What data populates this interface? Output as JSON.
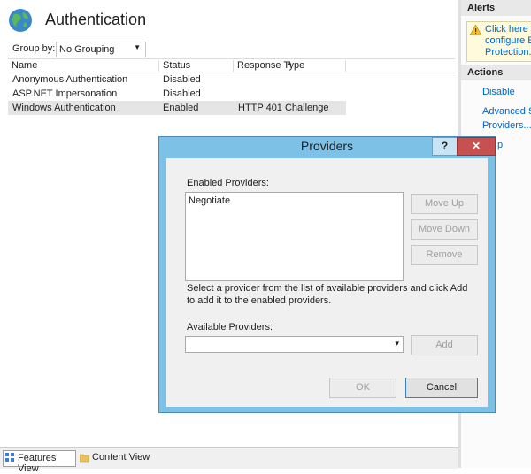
{
  "header": {
    "title": "Authentication"
  },
  "groupby": {
    "label": "Group by:",
    "value": "No Grouping"
  },
  "grid": {
    "columns": [
      "Name",
      "Status",
      "Response Type"
    ],
    "rows": [
      {
        "name": "Anonymous Authentication",
        "status": "Disabled",
        "response": ""
      },
      {
        "name": "ASP.NET Impersonation",
        "status": "Disabled",
        "response": ""
      },
      {
        "name": "Windows Authentication",
        "status": "Enabled",
        "response": "HTTP 401 Challenge"
      }
    ]
  },
  "tabs": {
    "features": "Features View",
    "content": "Content View"
  },
  "actions_pane": {
    "alerts_header": "Alerts",
    "alert_lines": [
      "Click here to",
      "configure Ex",
      "Protection."
    ],
    "actions_header": "Actions",
    "disable": "Disable",
    "advanced_line1": "Advanced Se",
    "advanced_line2": "Providers...",
    "help_fragment": "p"
  },
  "dialog": {
    "title": "Providers",
    "help_glyph": "?",
    "close_glyph": "✕",
    "enabled_label": "Enabled Providers:",
    "enabled_items": [
      "Negotiate"
    ],
    "move_up": "Move Up",
    "move_down": "Move Down",
    "remove": "Remove",
    "hint_line1": "Select a provider from the list of available providers and click Add",
    "hint_line2": "to add it to the enabled providers.",
    "available_label": "Available Providers:",
    "available_value": "",
    "add": "Add",
    "ok": "OK",
    "cancel": "Cancel"
  },
  "colors": {
    "dialog_frame": "#7ec1e6",
    "close_button": "#c75050",
    "link": "#0066cc"
  }
}
